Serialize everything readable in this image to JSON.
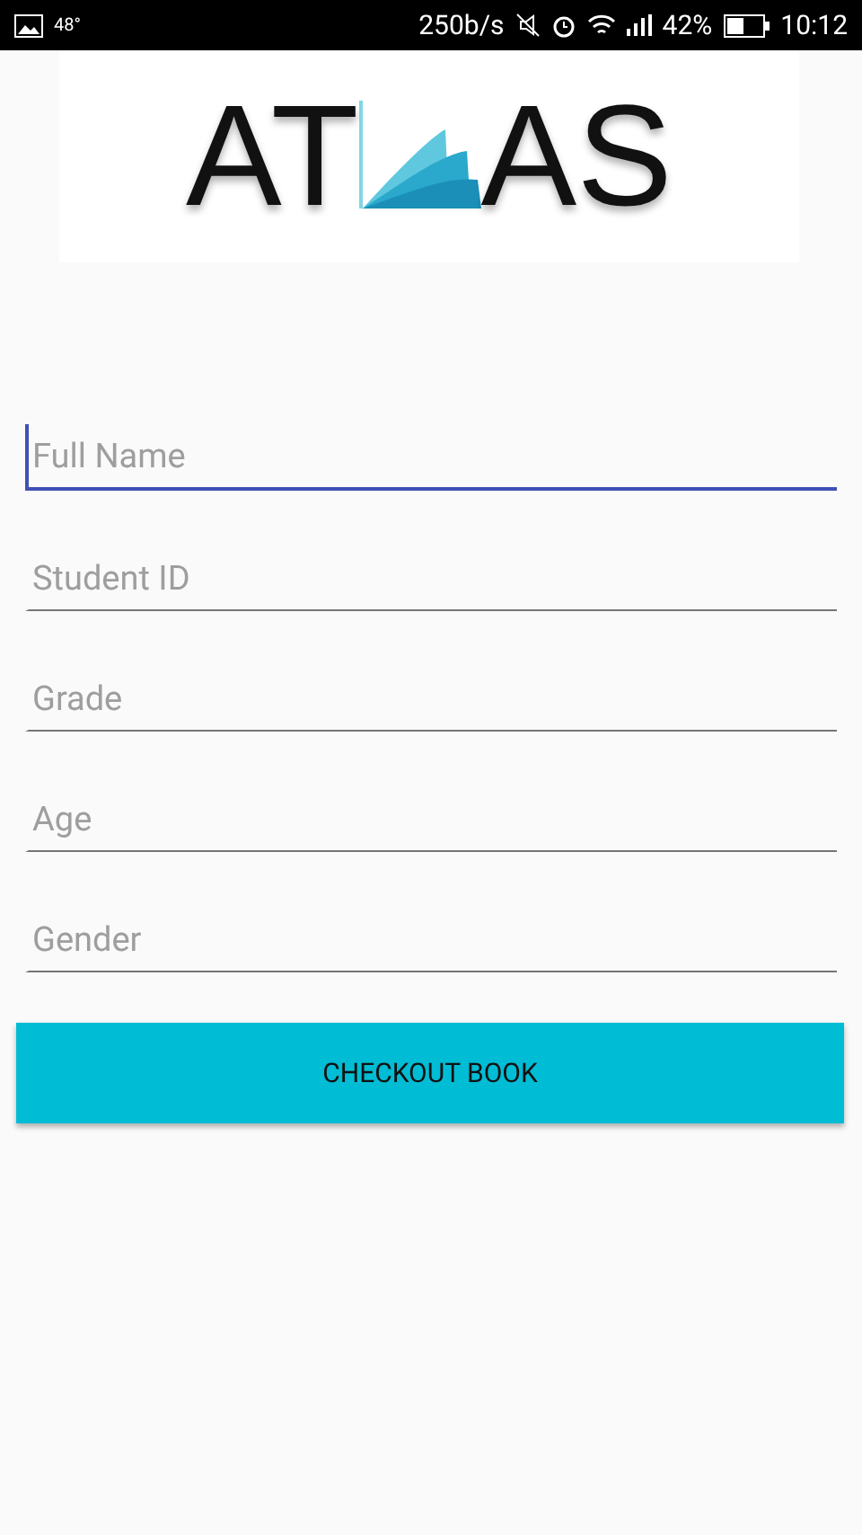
{
  "status_bar": {
    "temperature": "48°",
    "speed": "250b/s",
    "battery": "42%",
    "time": "10:12"
  },
  "logo": {
    "left": "AT",
    "right": "AS"
  },
  "fields": [
    {
      "placeholder": "Full Name",
      "focused": true
    },
    {
      "placeholder": "Student ID",
      "focused": false
    },
    {
      "placeholder": "Grade",
      "focused": false
    },
    {
      "placeholder": "Age",
      "focused": false
    },
    {
      "placeholder": "Gender",
      "focused": false
    }
  ],
  "button": "CHECKOUT BOOK"
}
